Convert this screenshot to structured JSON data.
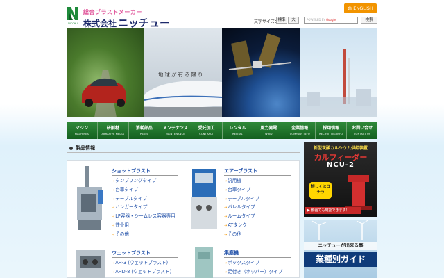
{
  "header": {
    "logo_tagline": "総合ブラストメーカー",
    "logo_company_prefix": "株式会社",
    "logo_company_name": "ニッチュー",
    "logo_mark_text": "NICCHU",
    "english_label": "ENGLISH",
    "text_size_label": "文字サイズ：",
    "text_size_standard": "標準",
    "text_size_large": "大",
    "search_placeholder_brand": "POWERED BY",
    "search_placeholder_logo": "Google",
    "search_button_label": "検索"
  },
  "hero": {
    "tagline": "地球が有る限り"
  },
  "nav": [
    {
      "jp": "マシン",
      "en": "MACHINES"
    },
    {
      "jp": "研削材",
      "en": "ABRASIVE MEDIA"
    },
    {
      "jp": "消耗部品",
      "en": "PARTS"
    },
    {
      "jp": "メンテナンス",
      "en": "MAINTENANCE"
    },
    {
      "jp": "受託加工",
      "en": "CONTRACT"
    },
    {
      "jp": "レンタル",
      "en": "RENTAL"
    },
    {
      "jp": "風力発電",
      "en": "WIND"
    },
    {
      "jp": "企業情報",
      "en": "COMPANY INFO"
    },
    {
      "jp": "採用情報",
      "en": "RECRUITING INFO"
    },
    {
      "jp": "お問い合せ",
      "en": "CONTACT US"
    }
  ],
  "products": {
    "heading": "製品情報",
    "categories": [
      {
        "title": "ショットブラスト",
        "items": [
          "タンブリングタイプ",
          "台車タイプ",
          "テーブルタイプ",
          "ハンガータイプ",
          "LP容器・シームレス容器専用",
          "鉄骨用",
          "その他"
        ]
      },
      {
        "title": "エアーブラスト",
        "items": [
          "汎用機",
          "台車タイプ",
          "テーブルタイプ",
          "バレルタイプ",
          "ルームタイプ",
          "ATタンク",
          "その他"
        ]
      },
      {
        "title": "ウェットブラスト",
        "items": [
          "AH-3 (ウェットブラスト)",
          "AHD-8 (ウェットブラスト)"
        ]
      },
      {
        "title": "集塵機",
        "items": [
          "ボックスタイプ",
          "足付き（ホッパー）タイプ"
        ]
      }
    ]
  },
  "banners": {
    "calfeeder": {
      "sub": "新型炭酸カルシウム供給装置",
      "title": "カルフィーダー",
      "model": "NCU-2",
      "detail": "詳しくはコチラ",
      "video": "動画でも確認できます！"
    },
    "guide": {
      "sub": "ニッチューが出来る事",
      "title": "業種別ガイド"
    }
  },
  "colors": {
    "nav_green": "#1b6e2b",
    "link_blue": "#1f4fa8",
    "accent_orange": "#f29400",
    "brand_pink": "#e0559a",
    "brand_navy": "#1d2a6b"
  }
}
